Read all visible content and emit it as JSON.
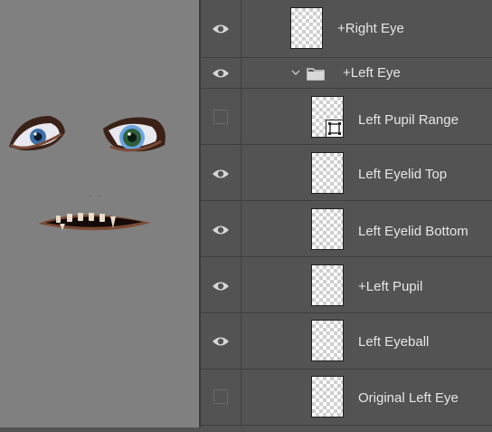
{
  "layers": [
    {
      "name": "+Right Eye",
      "visible": true,
      "icon": "layer-thumbnail"
    },
    {
      "name": "+Left Eye",
      "visible": true,
      "icon": "folder-icon",
      "expanded": true
    },
    {
      "name": "Left Pupil Range",
      "visible": false,
      "icon": "smart-object-badge"
    },
    {
      "name": "Left Eyelid Top",
      "visible": true,
      "icon": "layer-thumbnail"
    },
    {
      "name": "Left Eyelid Bottom",
      "visible": true,
      "icon": "layer-thumbnail"
    },
    {
      "name": "+Left Pupil",
      "visible": true,
      "icon": "layer-thumbnail"
    },
    {
      "name": "Left Eyeball",
      "visible": true,
      "icon": "layer-thumbnail"
    },
    {
      "name": "Original Left Eye",
      "visible": false,
      "icon": "layer-thumbnail"
    }
  ],
  "colors": {
    "canvas_bg": "#808080",
    "panel_bg": "#535353",
    "text": "#e6e6e6"
  }
}
